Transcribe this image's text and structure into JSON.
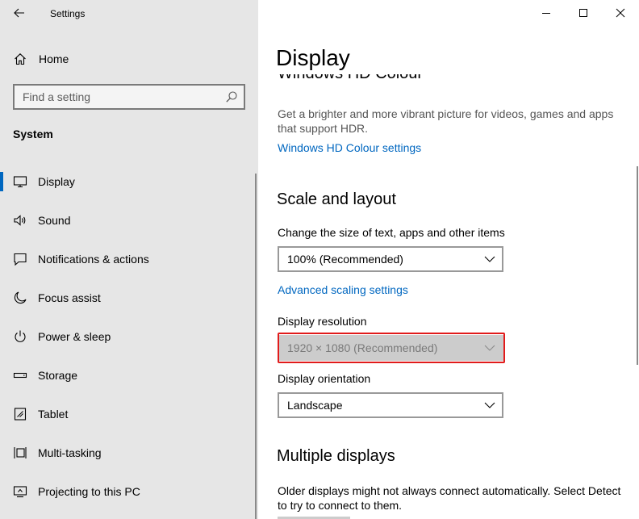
{
  "app": {
    "title": "Settings"
  },
  "sidebar": {
    "home_label": "Home",
    "search_placeholder": "Find a setting",
    "section_label": "System",
    "items": [
      {
        "label": "Display",
        "icon": "monitor-icon",
        "active": true
      },
      {
        "label": "Sound",
        "icon": "speaker-icon"
      },
      {
        "label": "Notifications & actions",
        "icon": "notification-icon"
      },
      {
        "label": "Focus assist",
        "icon": "moon-icon"
      },
      {
        "label": "Power & sleep",
        "icon": "power-icon"
      },
      {
        "label": "Storage",
        "icon": "storage-icon"
      },
      {
        "label": "Tablet",
        "icon": "tablet-icon"
      },
      {
        "label": "Multi-tasking",
        "icon": "multitasking-icon"
      },
      {
        "label": "Projecting to this PC",
        "icon": "projecting-icon"
      }
    ]
  },
  "main": {
    "page_title": "Display",
    "hd_colour": {
      "heading": "Windows HD Colour",
      "description": "Get a brighter and more vibrant picture for videos, games and apps that support HDR.",
      "link": "Windows HD Colour settings"
    },
    "scale_layout": {
      "heading": "Scale and layout",
      "size_label": "Change the size of text, apps and other items",
      "size_value": "100% (Recommended)",
      "advanced_link": "Advanced scaling settings",
      "resolution_label": "Display resolution",
      "resolution_value": "1920 × 1080 (Recommended)",
      "orientation_label": "Display orientation",
      "orientation_value": "Landscape"
    },
    "multiple_displays": {
      "heading": "Multiple displays",
      "description": "Older displays might not always connect automatically. Select Detect to try to connect to them."
    }
  },
  "colors": {
    "accent": "#0067c0",
    "sidebar_bg": "#e6e6e6",
    "highlight": "#e11b1b",
    "disabled_bg": "#cccccc"
  }
}
